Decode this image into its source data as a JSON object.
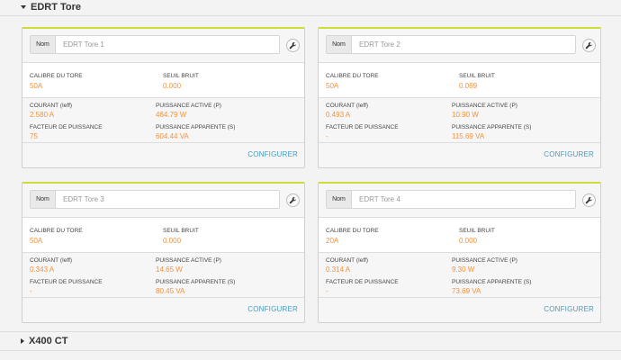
{
  "sections": {
    "edrt": {
      "title": "EDRT Tore",
      "expanded": true
    },
    "x400": {
      "title": "X400 CT",
      "expanded": false
    }
  },
  "labels": {
    "name_addon": "Nom",
    "calibre": "CALIBRE DU TORE",
    "seuil": "SEUIL BRUIT",
    "courant": "COURANT (Ieff)",
    "puissance_active": "PUISSANCE ACTIVE (P)",
    "facteur": "FACTEUR DE PUISSANCE",
    "puissance_apparente": "PUISSANCE APPARENTE (S)",
    "configure": "CONFIGURER"
  },
  "colors": {
    "accent_top": "#cddc39",
    "value": "#f5923e",
    "link": "#4a9bc4"
  },
  "icons": {
    "settings": "wrench-icon",
    "expand": "caret-down-icon",
    "collapse": "caret-right-icon"
  },
  "cards": [
    {
      "name_placeholder": "EDRT Tore 1",
      "calibre": "50A",
      "seuil": "0.000",
      "courant": "2.580 A",
      "puissance_active": "464.79 W",
      "facteur": "75",
      "puissance_apparente": "604.44 VA"
    },
    {
      "name_placeholder": "EDRT Tore 2",
      "calibre": "50A",
      "seuil": "0.069",
      "courant": "0.493 A",
      "puissance_active": "10.90 W",
      "facteur": "-",
      "puissance_apparente": "115.69 VA"
    },
    {
      "name_placeholder": "EDRT Tore 3",
      "calibre": "50A",
      "seuil": "0.000",
      "courant": "0.343 A",
      "puissance_active": "14.65 W",
      "facteur": "-",
      "puissance_apparente": "80.45 VA"
    },
    {
      "name_placeholder": "EDRT Tore 4",
      "calibre": "20A",
      "seuil": "0.000",
      "courant": "0.314 A",
      "puissance_active": "9.30 W",
      "facteur": "-",
      "puissance_apparente": "73.69 VA"
    }
  ]
}
